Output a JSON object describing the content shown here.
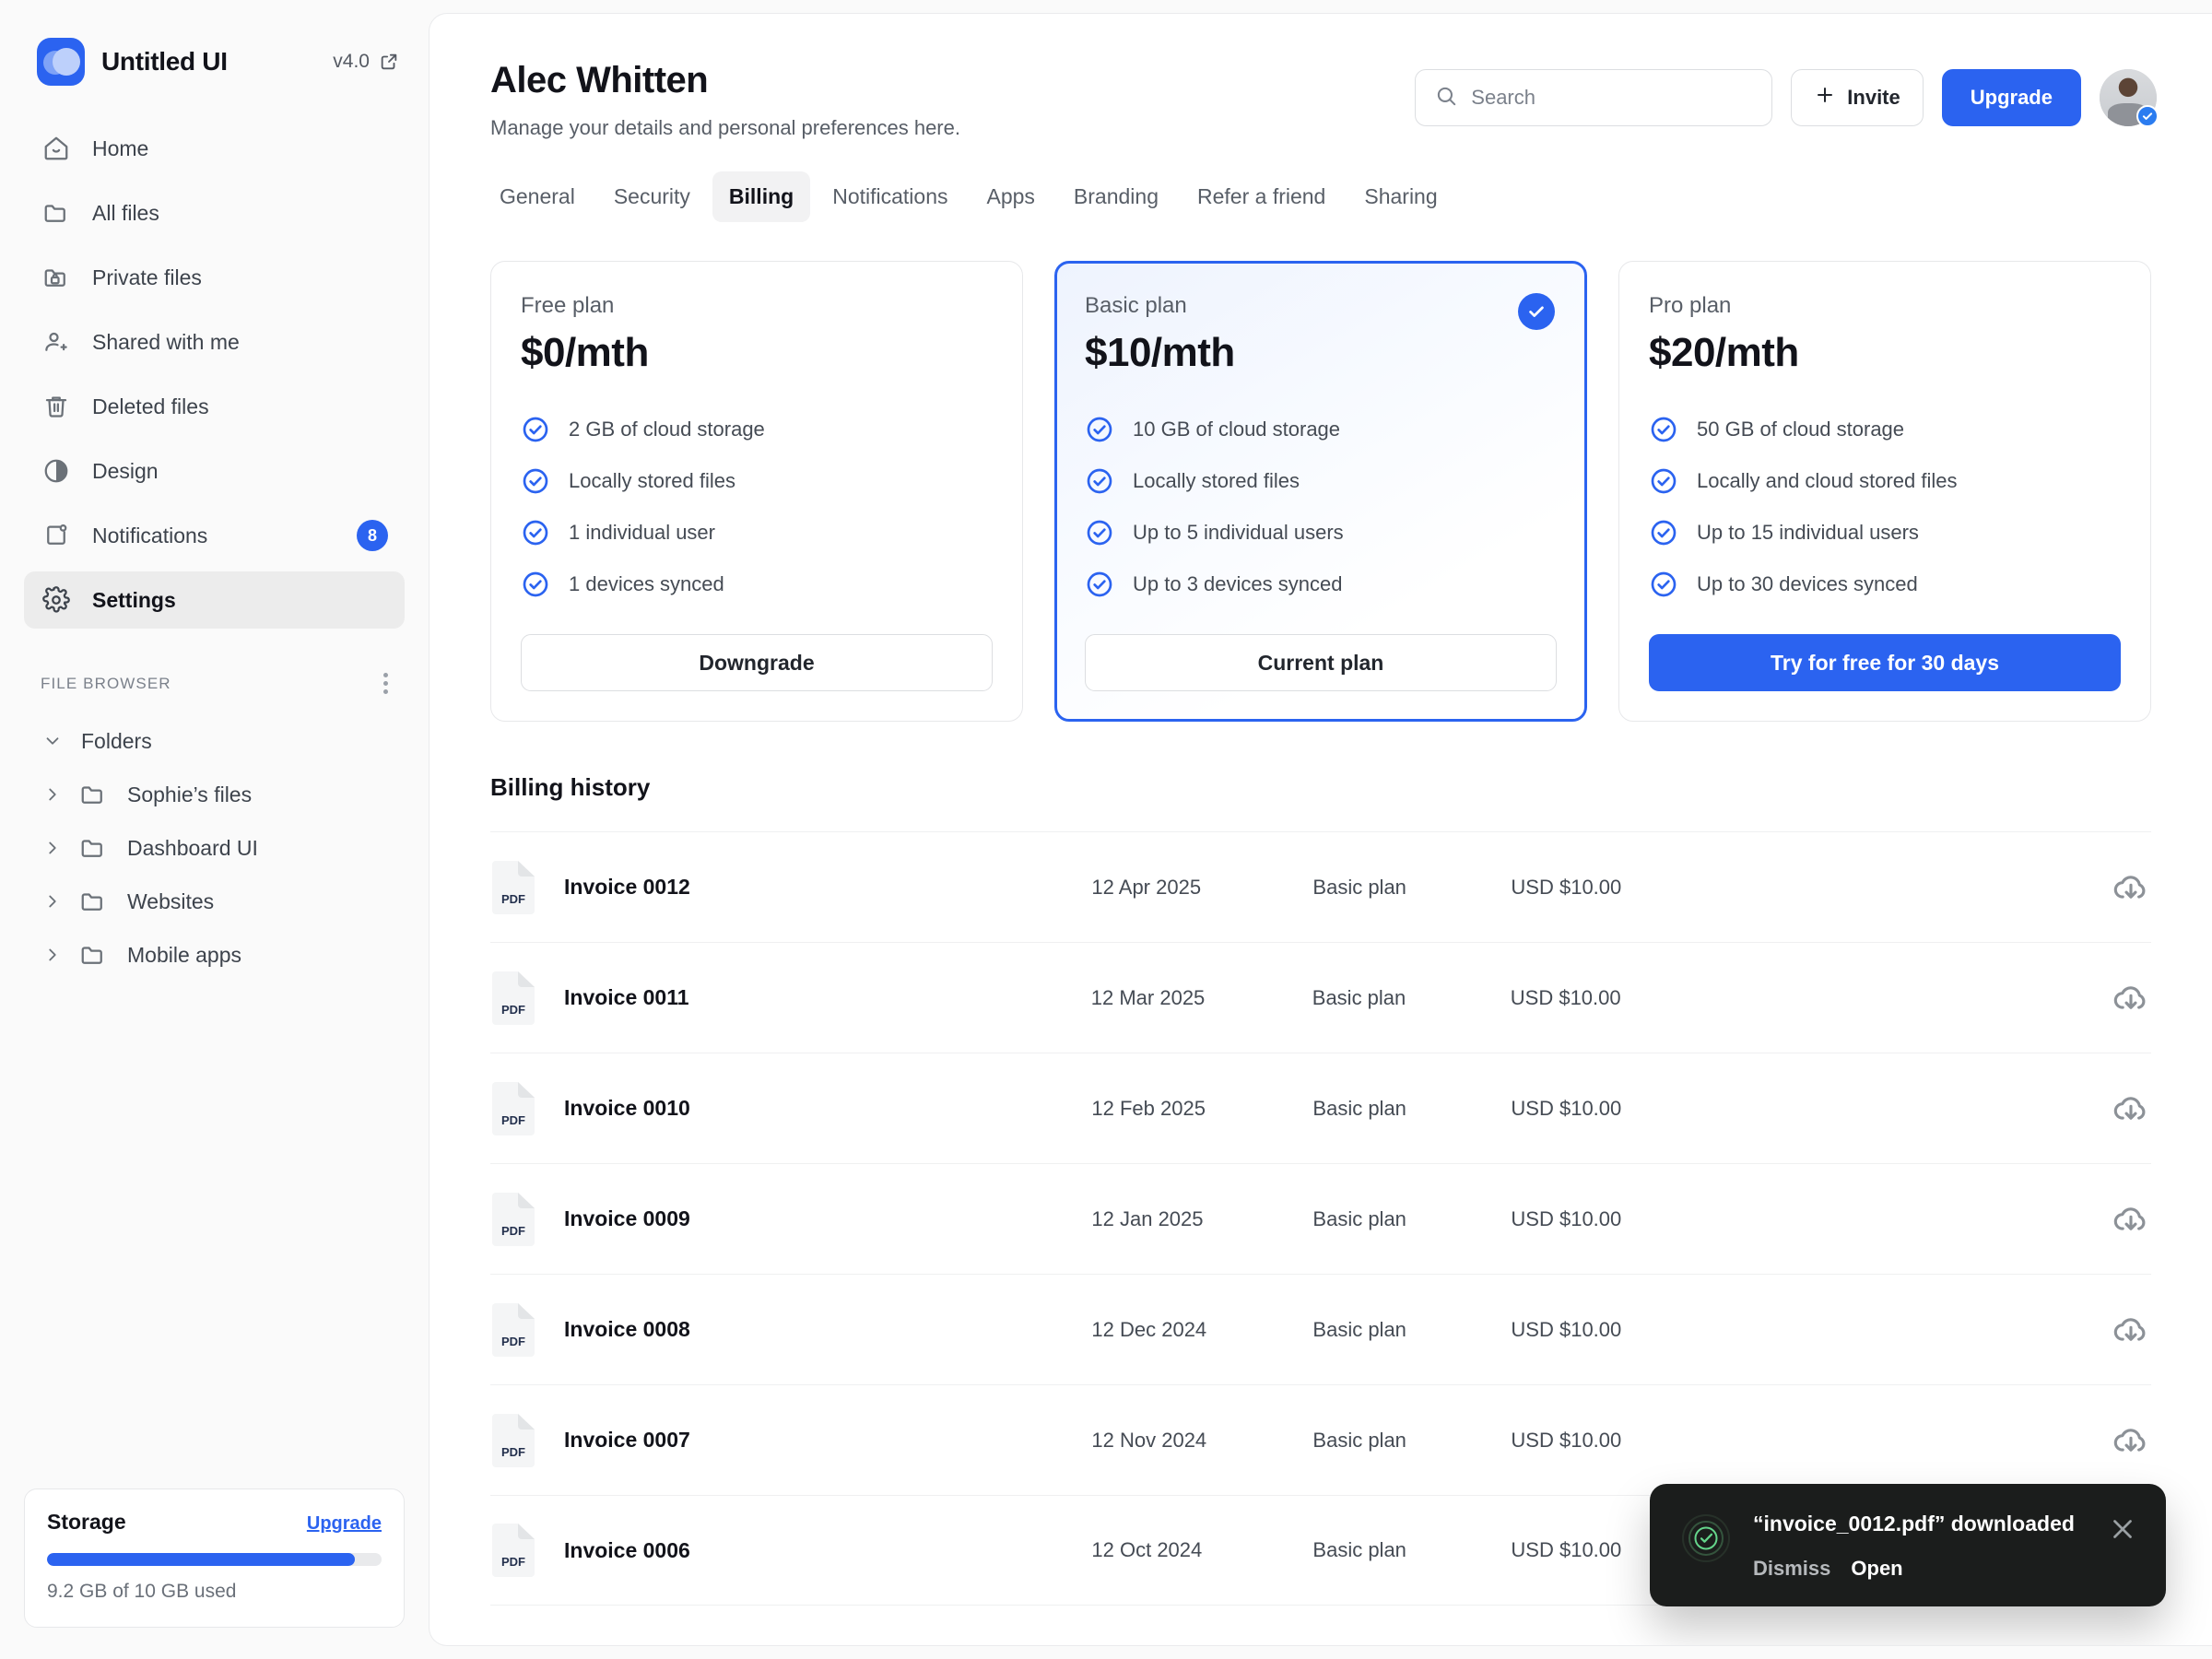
{
  "sidebar": {
    "brand": {
      "name": "Untitled UI",
      "version": "v4.0",
      "logo_icon": "logo-mark",
      "external_link_icon": "external-link-icon"
    },
    "nav": [
      {
        "label": "Home",
        "icon": "home-icon",
        "badge": null,
        "active": false
      },
      {
        "label": "All files",
        "icon": "folder-icon",
        "badge": null,
        "active": false
      },
      {
        "label": "Private files",
        "icon": "folder-lock-icon",
        "badge": null,
        "active": false
      },
      {
        "label": "Shared with me",
        "icon": "user-plus-icon",
        "badge": null,
        "active": false
      },
      {
        "label": "Deleted files",
        "icon": "trash-icon",
        "badge": null,
        "active": false
      },
      {
        "label": "Design",
        "icon": "contrast-circle-icon",
        "badge": null,
        "active": false
      },
      {
        "label": "Notifications",
        "icon": "bell-dot-icon",
        "badge": "8",
        "active": false
      },
      {
        "label": "Settings",
        "icon": "gear-icon",
        "badge": null,
        "active": true
      }
    ],
    "file_browser": {
      "title": "FILE BROWSER",
      "menu_icon": "dots-vertical-icon"
    },
    "tree": {
      "group_label": "Folders",
      "folders": [
        {
          "label": "Sophie’s files"
        },
        {
          "label": "Dashboard UI"
        },
        {
          "label": "Websites"
        },
        {
          "label": "Mobile apps"
        }
      ]
    },
    "storage": {
      "title": "Storage",
      "upgrade_label": "Upgrade",
      "used_text": "9.2 GB of 10 GB used",
      "percent": 92
    }
  },
  "header": {
    "title": "Alec Whitten",
    "subtitle": "Manage your details and personal preferences here.",
    "search": {
      "placeholder": "Search",
      "value": "",
      "icon": "search-icon"
    },
    "invite_label": "Invite",
    "invite_icon": "plus-icon",
    "upgrade_label": "Upgrade",
    "avatar": {
      "name": "avatar",
      "verified_icon": "verified-check-icon"
    }
  },
  "tabs": [
    {
      "label": "General",
      "active": false
    },
    {
      "label": "Security",
      "active": false
    },
    {
      "label": "Billing",
      "active": true
    },
    {
      "label": "Notifications",
      "active": false
    },
    {
      "label": "Apps",
      "active": false
    },
    {
      "label": "Branding",
      "active": false
    },
    {
      "label": "Refer a friend",
      "active": false
    },
    {
      "label": "Sharing",
      "active": false
    }
  ],
  "plans": [
    {
      "name": "Free plan",
      "price": "$0/mth",
      "selected": false,
      "features": [
        "2 GB of cloud storage",
        "Locally stored files",
        "1 individual user",
        "1 devices synced"
      ],
      "button_label": "Downgrade",
      "button_style": "outline"
    },
    {
      "name": "Basic plan",
      "price": "$10/mth",
      "selected": true,
      "selected_icon": "check-circle-filled-icon",
      "features": [
        "10 GB of cloud storage",
        "Locally stored files",
        "Up to 5 individual users",
        "Up to 3 devices synced"
      ],
      "button_label": "Current plan",
      "button_style": "outline"
    },
    {
      "name": "Pro plan",
      "price": "$20/mth",
      "selected": false,
      "features": [
        "50 GB of cloud storage",
        "Locally and cloud stored files",
        "Up to 15 individual users",
        "Up to 30 devices synced"
      ],
      "button_label": "Try for free for 30 days",
      "button_style": "solid"
    }
  ],
  "billing_history": {
    "title": "Billing history",
    "rows": [
      {
        "file_type": "PDF",
        "name": "Invoice 0012",
        "date": "12 Apr 2025",
        "plan": "Basic plan",
        "amount": "USD $10.00",
        "download_icon": "download-cloud-icon"
      },
      {
        "file_type": "PDF",
        "name": "Invoice 0011",
        "date": "12 Mar 2025",
        "plan": "Basic plan",
        "amount": "USD $10.00",
        "download_icon": "download-cloud-icon"
      },
      {
        "file_type": "PDF",
        "name": "Invoice 0010",
        "date": "12 Feb 2025",
        "plan": "Basic plan",
        "amount": "USD $10.00",
        "download_icon": "download-cloud-icon"
      },
      {
        "file_type": "PDF",
        "name": "Invoice 0009",
        "date": "12 Jan 2025",
        "plan": "Basic plan",
        "amount": "USD $10.00",
        "download_icon": "download-cloud-icon"
      },
      {
        "file_type": "PDF",
        "name": "Invoice 0008",
        "date": "12 Dec 2024",
        "plan": "Basic plan",
        "amount": "USD $10.00",
        "download_icon": "download-cloud-icon"
      },
      {
        "file_type": "PDF",
        "name": "Invoice 0007",
        "date": "12 Nov 2024",
        "plan": "Basic plan",
        "amount": "USD $10.00",
        "download_icon": "download-cloud-icon"
      },
      {
        "file_type": "PDF",
        "name": "Invoice 0006",
        "date": "12 Oct 2024",
        "plan": "Basic plan",
        "amount": "USD $10.00",
        "download_icon": "download-cloud-icon"
      }
    ]
  },
  "toast": {
    "message": "“invoice_0012.pdf” downloaded",
    "dismiss_label": "Dismiss",
    "open_label": "Open",
    "status_icon": "success-check-icon",
    "close_icon": "close-icon"
  },
  "colors": {
    "accent": "#2b63f0",
    "success": "#64d48a",
    "toast_bg": "#1b1d1c",
    "page_bg": "#fafafa"
  }
}
